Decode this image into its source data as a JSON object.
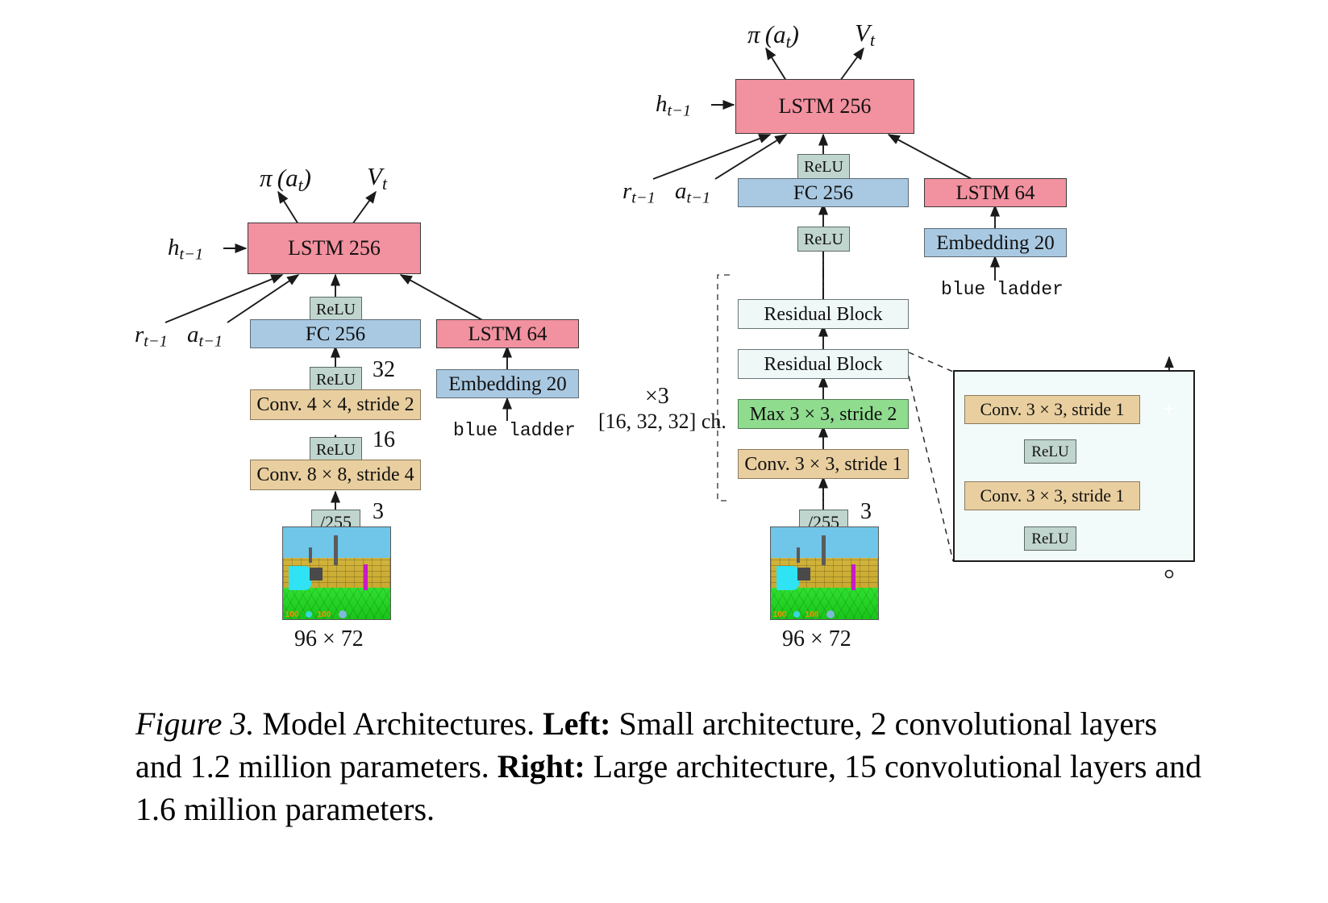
{
  "figure": {
    "caption_prefix": "Figure 3.",
    "caption_text_1": " Model Architectures. ",
    "caption_left_label": "Left:",
    "caption_text_2": " Small architecture, 2 convolutional layers and 1.2 million parameters. ",
    "caption_right_label": "Right:",
    "caption_text_3": " Large architecture, 15 convolutional layers and 1.6 million parameters."
  },
  "colors": {
    "lstm_pink": "#f2919f",
    "fc_blue": "#a9c9e2",
    "conv_tan": "#e9cf9f",
    "relu_sage": "#c0d5ce",
    "maxpool_green": "#8fdc8e",
    "residual_bg": "#eff7f7",
    "plus_circle": "#4d7a8f",
    "detail_bg": "#f2fafa"
  },
  "left_arch": {
    "title": "Small architecture",
    "outputs": [
      {
        "name": "policy-output",
        "label": "π (a",
        "sub": "t",
        "tail": ")"
      },
      {
        "name": "value-output",
        "label": "V",
        "sub": "t",
        "tail": ""
      }
    ],
    "policy_label": "π (aₜ)",
    "value_label": "Vₜ",
    "hidden_state_label": "h",
    "hidden_state_sub": "t−1",
    "reward_label": "r",
    "reward_sub": "t−1",
    "action_label": "a",
    "action_sub": "t−1",
    "blocks": {
      "lstm_main": "LSTM 256",
      "relu_top": "ReLU",
      "fc": "FC 256",
      "relu_mid": "ReLU",
      "conv2": "Conv. 4 × 4, stride 2",
      "relu_bot": "ReLU",
      "conv1": "Conv. 8 × 8, stride 4",
      "normalize": "/255",
      "lstm_lang": "LSTM 64",
      "embedding": "Embedding 20"
    },
    "channel_labels": {
      "conv2_out": "32",
      "conv1_out": "16",
      "input_ch": "3"
    },
    "instruction_text": "blue ladder",
    "input_size_label": "96 × 72"
  },
  "right_arch": {
    "title": "Large architecture",
    "policy_label": "π (aₜ)",
    "value_label": "Vₜ",
    "hidden_state_label": "h",
    "hidden_state_sub": "t−1",
    "reward_label": "r",
    "reward_sub": "t−1",
    "action_label": "a",
    "action_sub": "t−1",
    "blocks": {
      "lstm_main": "LSTM 256",
      "relu_top": "ReLU",
      "fc": "FC 256",
      "relu_mid": "ReLU",
      "residual_block_2": "Residual Block",
      "residual_block_1": "Residual Block",
      "maxpool": "Max 3 × 3, stride 2",
      "conv": "Conv. 3 × 3, stride 1",
      "normalize": "/255",
      "lstm_lang": "LSTM 64",
      "embedding": "Embedding 20"
    },
    "repeat_label": "×3",
    "channels_label": "[16, 32, 32] ch.",
    "input_ch_label": "3",
    "instruction_text": "blue ladder",
    "input_size_label": "96 × 72"
  },
  "residual_detail": {
    "conv_top": "Conv. 3 × 3, stride 1",
    "relu_mid": "ReLU",
    "conv_bottom": "Conv. 3 × 3, stride 1",
    "relu_bottom": "ReLU",
    "add_symbol": "+"
  },
  "screenshot": {
    "hud_left_value": "100",
    "hud_right_value": "100"
  }
}
